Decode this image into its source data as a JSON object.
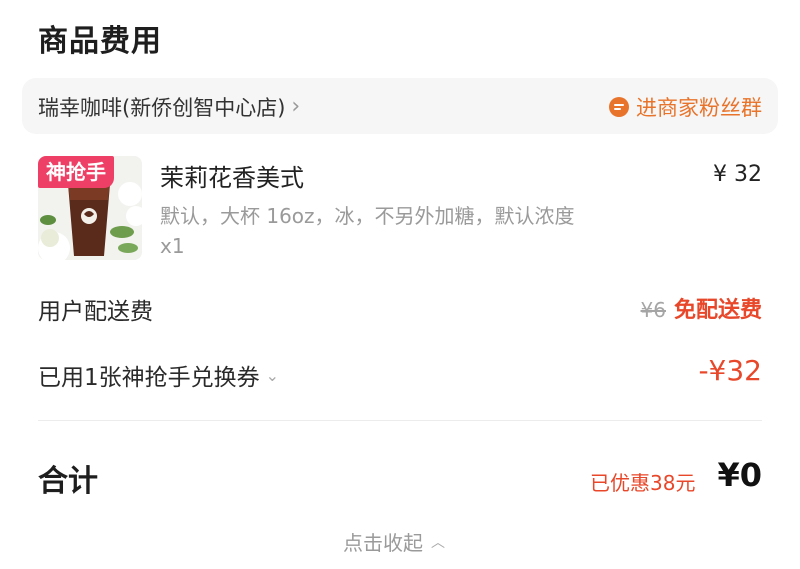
{
  "section_title": "商品费用",
  "store": {
    "name": "瑞幸咖啡(新侨创智中心店)",
    "fans_link": "进商家粉丝群",
    "fans_icon": "chat-bubble-icon",
    "accent_color": "#e8742b"
  },
  "product": {
    "badge": "神抢手",
    "badge_color": "#ee3f66",
    "name": "茉莉花香美式",
    "spec": "默认，大杯 16oz，冰，不另外加糖，默认浓度",
    "quantity": "x1",
    "price": "¥ 32",
    "image": "iced-coffee-cup-with-jasmine-flowers"
  },
  "delivery": {
    "label": "用户配送费",
    "original_fee": "¥6",
    "status": "免配送费"
  },
  "coupon": {
    "label": "已用1张神抢手兑换券",
    "amount": "-¥32"
  },
  "total": {
    "label": "合计",
    "discount_text": "已优惠38元",
    "amount": "¥0"
  },
  "collapse_label": "点击收起",
  "colors": {
    "discount_red": "#e8472a",
    "muted_gray": "#9a9a9a"
  }
}
